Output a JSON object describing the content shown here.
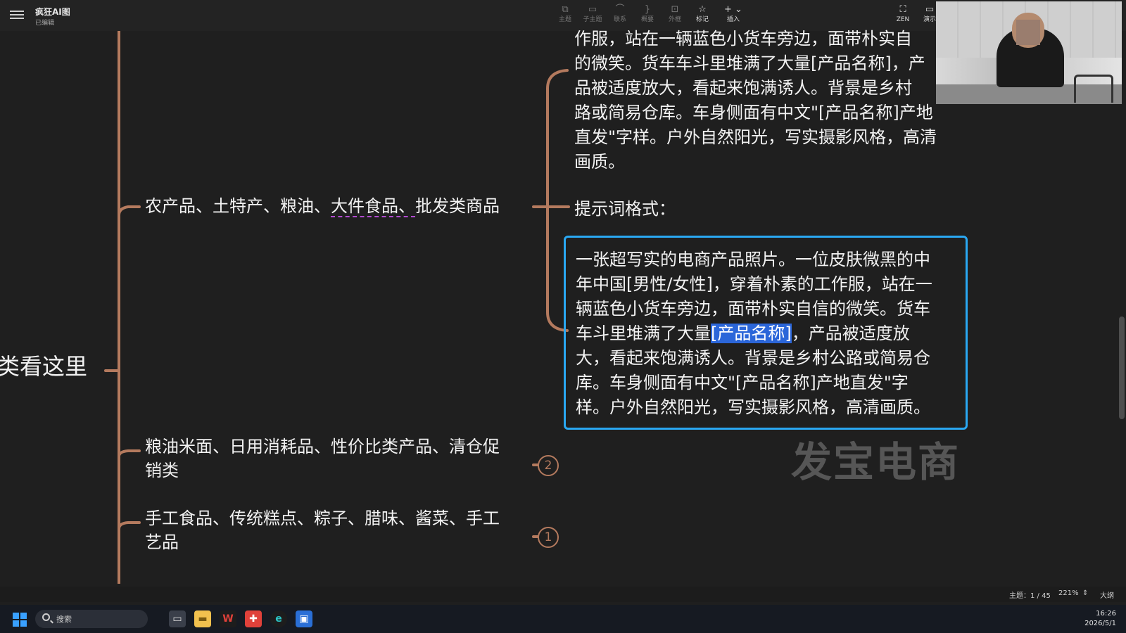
{
  "app": {
    "title": "疯狂AI图",
    "status": "已编辑"
  },
  "toolbar": {
    "items": [
      {
        "label": "主题",
        "icon": "topic-icon"
      },
      {
        "label": "子主题",
        "icon": "subtopic-icon"
      },
      {
        "label": "联系",
        "icon": "relation-icon"
      },
      {
        "label": "概要",
        "icon": "summary-icon"
      },
      {
        "label": "外框",
        "icon": "boundary-icon"
      },
      {
        "label": "标记",
        "icon": "star-icon"
      },
      {
        "label": "插入",
        "icon": "plus-icon"
      }
    ],
    "right": [
      {
        "label": "ZEN",
        "icon": "fullscreen-icon"
      },
      {
        "label": "演示",
        "icon": "present-icon"
      }
    ]
  },
  "mindmap": {
    "root_text": "类看这里",
    "branches": [
      {
        "text_a": "农产品、土特产、粮油、",
        "text_b": "大件食品、",
        "text_c": "批发类商品"
      },
      {
        "line1": "粮油米面、日用消耗品、性价比类产品、清仓促",
        "line2": "销类",
        "badge": "2"
      },
      {
        "line1": "手工食品、传统糕点、粽子、腊味、酱菜、手工",
        "line2": "艺品",
        "badge": "1"
      }
    ],
    "note_lines": [
      "作服，站在一辆蓝色小货车旁边，面带朴实自",
      "的微笑。货车车斗里堆满了大量[产品名称]，产",
      "品被适度放大，看起来饱满诱人。背景是乡村",
      "路或简易仓库。车身侧面有中文\"[产品名称]产地",
      "直发\"字样。户外自然阳光，写实摄影风格，高清",
      "画质。"
    ],
    "format_label": "提示词格式：",
    "edit": {
      "l1": "一张超写实的电商产品照片。一位皮肤微黑的中",
      "l2": "年中国[男性/女性]，穿着朴素的工作服，站在一",
      "l3": "辆蓝色小货车旁边，面带朴实自信的微笑。货车",
      "l4_pre": "车斗里堆满了大量",
      "l4_sel": "[产品名称]",
      "l4_post": "，产品被适度放",
      "l5": "大，看起来饱满诱人。背景是乡村公路或简易仓",
      "l6": "库。车身侧面有中文\"[产品名称]产地直发\"字",
      "l7": "样。户外自然阳光，写实摄影风格，高清画质。"
    },
    "watermark": "发宝电商"
  },
  "statusbar": {
    "topic_count": "主题：1 / 45",
    "zoom": "221%",
    "outline": "大纲"
  },
  "taskbar": {
    "search_placeholder": "搜索",
    "time": "16:26",
    "date": "2026/5/1"
  },
  "colors": {
    "branch": "#b47a5e",
    "selection": "#2b66d9",
    "edit_border": "#2aa8f2",
    "dash_underline": "#b24bd1"
  }
}
